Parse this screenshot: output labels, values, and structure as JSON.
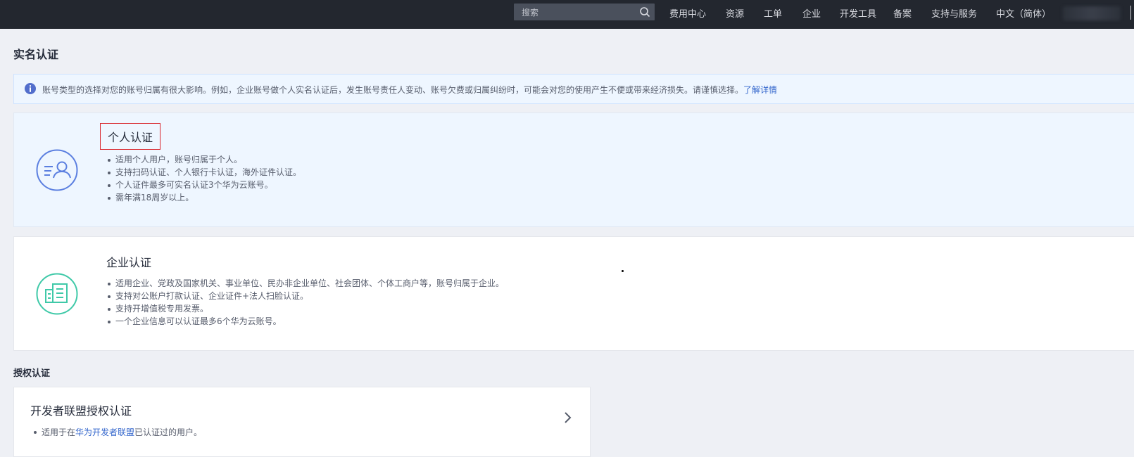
{
  "header": {
    "search_placeholder": "搜索",
    "nav": [
      "费用中心",
      "资源",
      "工单",
      "企业",
      "开发工具",
      "备案",
      "支持与服务",
      "中文（简体）"
    ]
  },
  "page": {
    "title": "实名认证",
    "notice": {
      "text": "账号类型的选择对您的账号归属有很大影响。例如，企业账号做个人实名认证后，发生账号责任人变动、账号欠费或归属纠纷时，可能会对您的使用产生不便或带来经济损失。请谨慎选择。",
      "link": "了解详情"
    }
  },
  "cards": [
    {
      "title": "个人认证",
      "bullets": [
        "适用个人用户，账号归属于个人。",
        "支持扫码认证、个人银行卡认证，海外证件认证。",
        "个人证件最多可实名认证3个华为云账号。",
        "需年满18周岁以上。"
      ]
    },
    {
      "title": "企业认证",
      "bullets": [
        "适用企业、党政及国家机关、事业单位、民办非企业单位、社会团体、个体工商户等，账号归属于企业。",
        "支持对公账户打款认证、企业证件+法人扫脸认证。",
        "支持开增值税专用发票。",
        "一个企业信息可以认证最多6个华为云账号。"
      ]
    }
  ],
  "authorization": {
    "section_title": "授权认证",
    "card_title": "开发者联盟授权认证",
    "desc_before": "适用于在",
    "desc_link": "华为开发者联盟",
    "desc_after": "已认证过的用户。"
  },
  "colors": {
    "topbar": "#23272f",
    "accent_link": "#3366cc",
    "personal_icon": "#5b7fe0",
    "enterprise_icon": "#3fc9a8",
    "highlight_border": "#d9262c"
  },
  "icons": [
    "search-icon",
    "info-icon",
    "personal-id-icon",
    "enterprise-building-icon",
    "chevron-right-icon"
  ]
}
